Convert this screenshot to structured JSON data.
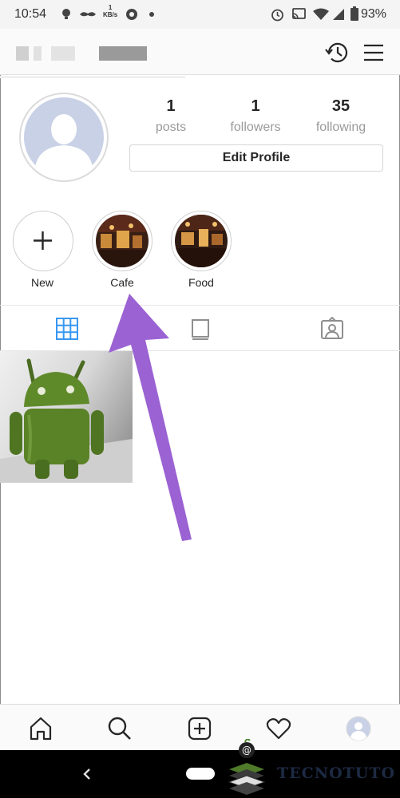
{
  "status_bar": {
    "time": "10:54",
    "speed_value": "1",
    "speed_unit": "KB/s",
    "battery": "93%",
    "icons": [
      "lightbulb-icon",
      "mustache-icon",
      "aperture-icon",
      "dot-icon",
      "alarm-icon",
      "cast-icon",
      "wifi-icon",
      "signal-icon",
      "battery-icon"
    ]
  },
  "header": {
    "icons": [
      "archive-history-icon",
      "menu-icon"
    ]
  },
  "profile": {
    "stats": [
      {
        "value": "1",
        "label": "posts"
      },
      {
        "value": "1",
        "label": "followers"
      },
      {
        "value": "35",
        "label": "following"
      }
    ],
    "edit_button": "Edit Profile"
  },
  "highlights": [
    {
      "label": "New",
      "icon": "plus-icon"
    },
    {
      "label": "Cafe"
    },
    {
      "label": "Food"
    }
  ],
  "tabs": [
    "grid-icon",
    "feed-icon",
    "tagged-icon"
  ],
  "bottom_nav": [
    "home-icon",
    "search-icon",
    "add-post-icon",
    "heart-icon",
    "profile-avatar-icon"
  ],
  "system_nav": [
    "back-icon",
    "home-pill"
  ],
  "watermark": {
    "text": "TECNOTUTO"
  },
  "colors": {
    "annotation_arrow": "#9b62d3",
    "active_tab": "#3897f0",
    "muted_text": "#9a9a9a"
  }
}
